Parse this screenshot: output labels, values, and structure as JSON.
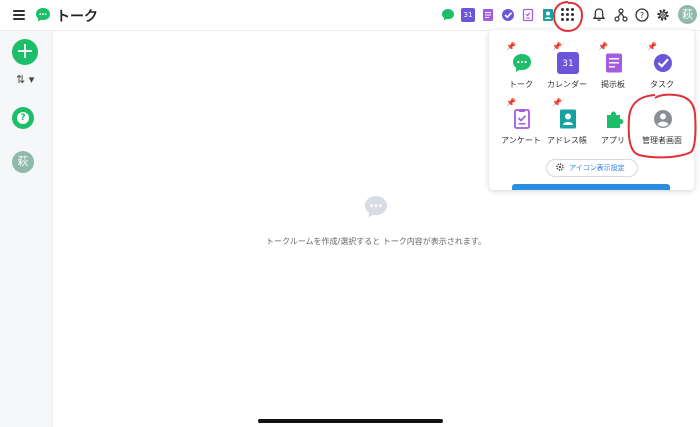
{
  "header": {
    "title": "トーク",
    "avatar_initial": "萩"
  },
  "toolbar": {
    "quick_apps": [
      "talk-icon",
      "calendar-icon",
      "board-icon",
      "task-icon",
      "survey-icon",
      "address-book-icon"
    ],
    "right_icons": [
      "bell-icon",
      "org-chart-icon",
      "help-icon",
      "gear-icon"
    ],
    "calendar_day": "31"
  },
  "sidebar": {
    "new_label": "+",
    "sort_label": "⇅ ▾",
    "help_label": "?",
    "avatar_initial": "萩"
  },
  "main": {
    "empty_message": "トークルームを作成/選択すると トーク内容が表示されます。"
  },
  "app_menu": {
    "items": [
      {
        "label": "トーク",
        "pinned": true
      },
      {
        "label": "カレンダー",
        "pinned": true,
        "day": "31"
      },
      {
        "label": "掲示板",
        "pinned": true
      },
      {
        "label": "タスク",
        "pinned": true
      },
      {
        "label": "アンケート",
        "pinned": true
      },
      {
        "label": "アドレス帳",
        "pinned": true
      },
      {
        "label": "アプリ",
        "pinned": false
      },
      {
        "label": "管理者画面",
        "pinned": false
      }
    ],
    "settings_label": "アイコン表示設定"
  },
  "colors": {
    "brand_green": "#1dbe6a",
    "accent_blue": "#2a7de1",
    "annotation_red": "#e0303a",
    "avatar": "#8fb9a9"
  }
}
